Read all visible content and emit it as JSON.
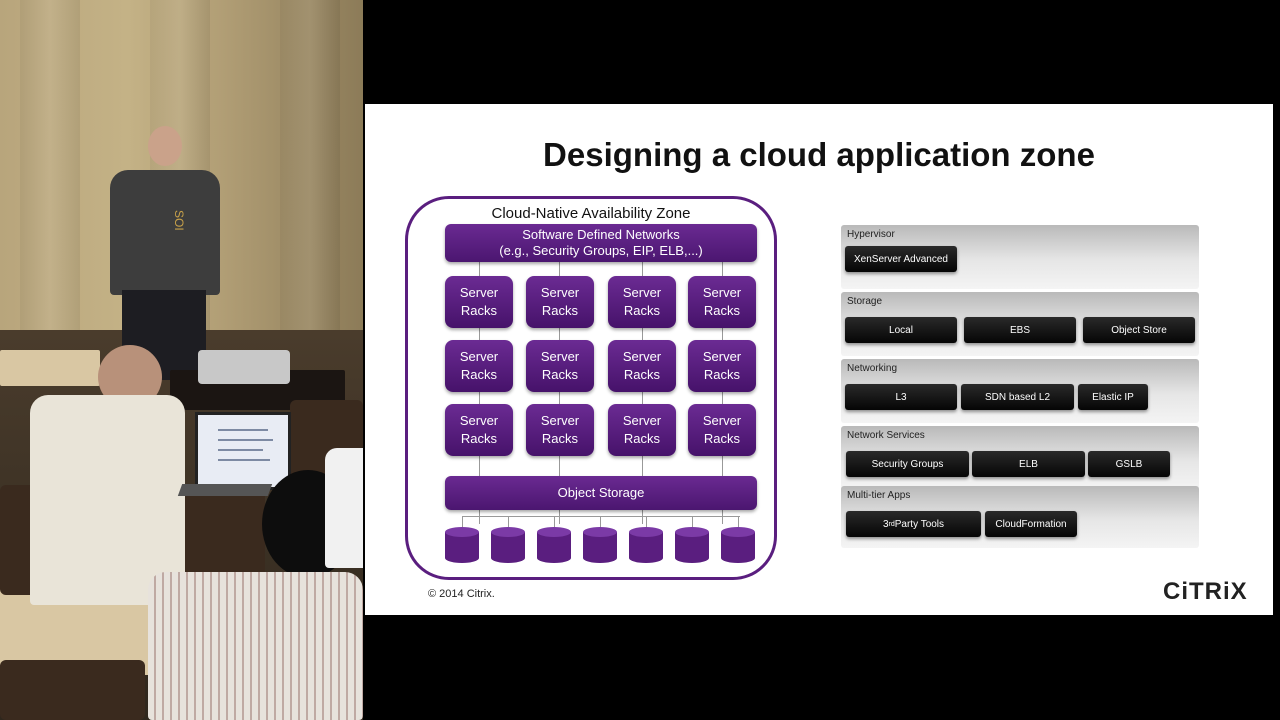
{
  "slide": {
    "title": "Designing a cloud application zone",
    "copyright": "© 2014 Citrix.",
    "brand": "CiTRiX"
  },
  "diagram": {
    "zone_title": "Cloud-Native Availability Zone",
    "sdn_line1": "Software Defined Networks",
    "sdn_line2": "(e.g., Security Groups, EIP, ELB,...)",
    "rack_line1": "Server",
    "rack_line2": "Racks",
    "object_storage": "Object Storage",
    "colors": {
      "purple": "#5a1e7f",
      "purple_dark": "#46126a"
    }
  },
  "stack": {
    "hypervisor": {
      "label": "Hypervisor",
      "items": [
        "XenServer Advanced"
      ]
    },
    "storage": {
      "label": "Storage",
      "items": [
        "Local",
        "EBS",
        "Object Store"
      ]
    },
    "networking": {
      "label": "Networking",
      "items": [
        "L3",
        "SDN based L2",
        "Elastic IP"
      ]
    },
    "network_services": {
      "label": "Network Services",
      "items": [
        "Security Groups",
        "ELB",
        "GSLB"
      ]
    },
    "multitier": {
      "label": "Multi-tier Apps",
      "items": [
        "3rd Party Tools",
        "CloudFormation"
      ],
      "tools_base": "3",
      "tools_sup": "rd",
      "tools_rest": " Party Tools"
    }
  },
  "room": {
    "shirt_text": "SOI"
  }
}
